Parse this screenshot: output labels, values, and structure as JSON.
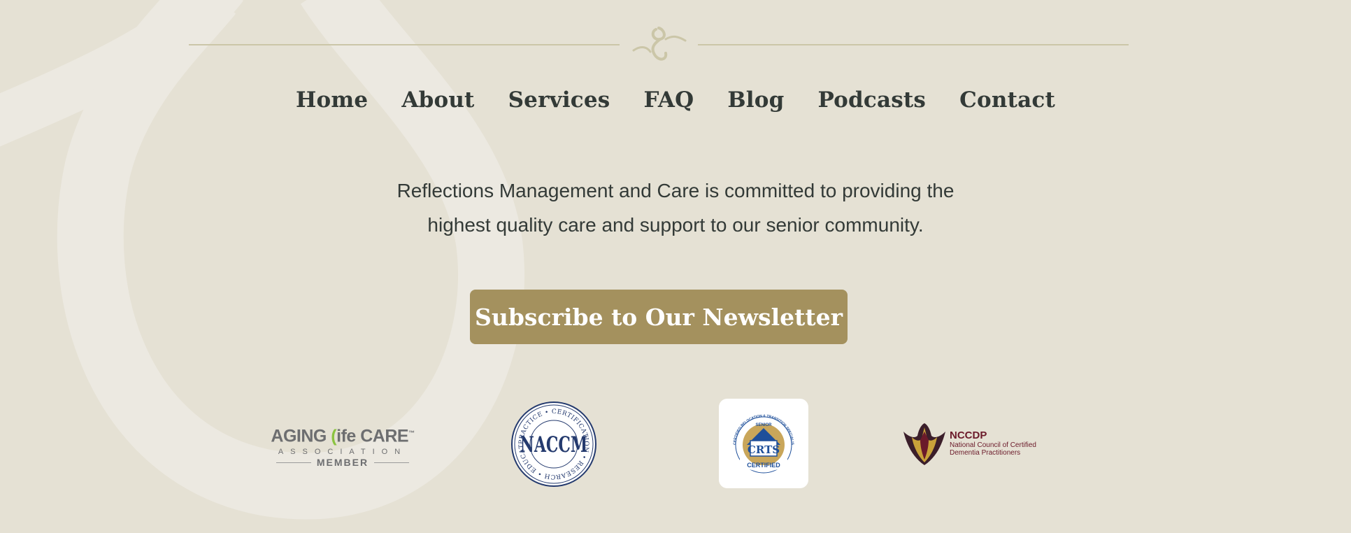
{
  "nav": {
    "items": [
      {
        "label": "Home"
      },
      {
        "label": "About"
      },
      {
        "label": "Services"
      },
      {
        "label": "FAQ"
      },
      {
        "label": "Blog"
      },
      {
        "label": "Podcasts"
      },
      {
        "label": "Contact"
      }
    ]
  },
  "mission": {
    "line1": "Reflections Management and Care is committed to providing the",
    "line2": "highest quality care and support to our senior community."
  },
  "subscribe": {
    "label": "Subscribe to Our Newsletter"
  },
  "logos": {
    "alca": {
      "name_left": "AGING ",
      "leaf": "(",
      "name_right": "ife CARE",
      "tm": "™",
      "assoc": "ASSOCIATION",
      "member": "MEMBER"
    },
    "naccm": {
      "center": "NACCM",
      "ring_top": "CERTIFICATION",
      "ring_right": "RESEARCH",
      "ring_bottom": "EDUCATION",
      "ring_left": "PRACTICE"
    },
    "crts": {
      "arc": "CERTIFIED RELOCATION & TRANSITION SPECIALIST",
      "senior": "SENIOR",
      "center": "CRTS",
      "certified": "CERTIFIED"
    },
    "nccdp": {
      "title": "NCCDP",
      "sub1": "National Council of Certified",
      "sub2": "Dementia Practitioners"
    }
  },
  "colors": {
    "background": "#e5e1d4",
    "text": "#333a37",
    "button": "#a4915e",
    "button_text": "#ffffff",
    "divider": "#cbc6a8",
    "nccdp_brand": "#6b1a2a",
    "naccm_brand": "#243a6e"
  }
}
